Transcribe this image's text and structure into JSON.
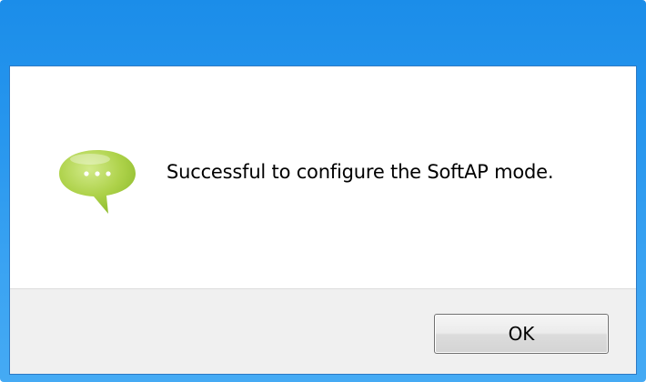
{
  "dialog": {
    "message": "Successful to configure the SoftAP mode.",
    "icon": "speech-bubble-icon",
    "ok_label": "OK"
  },
  "colors": {
    "titlebar": "#2796ee",
    "icon_green": "#a8cf45",
    "footer": "#f0f0f0"
  }
}
